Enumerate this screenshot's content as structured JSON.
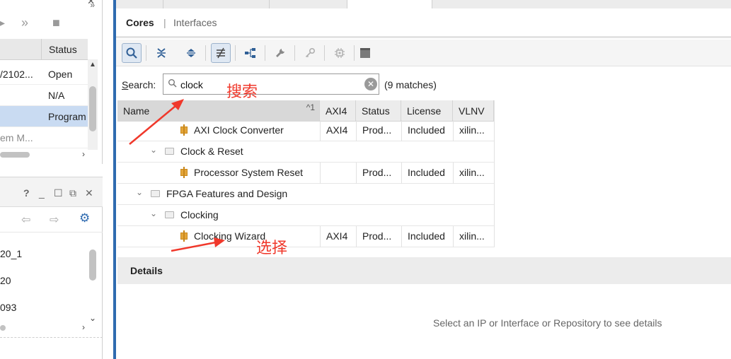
{
  "left_top_panel": {
    "columns": [
      "",
      "Status"
    ],
    "rows": [
      {
        "name": "/2102...",
        "status": "Open"
      },
      {
        "name": "",
        "status": "N/A"
      },
      {
        "name": "",
        "status": "Program"
      },
      {
        "name": "em M...",
        "status": ""
      }
    ]
  },
  "left_bottom_panel": {
    "controls": [
      "?",
      "_",
      "☐",
      "⧉",
      "✕"
    ],
    "items": [
      "20_1",
      "20",
      "093"
    ]
  },
  "view_tabs": {
    "cores": "Cores",
    "separator": "|",
    "interfaces": "Interfaces"
  },
  "search": {
    "label_prefix": "S",
    "label_rest": "earch:",
    "value": "clock",
    "match_text": "(9 matches)"
  },
  "grid": {
    "headers": {
      "name": "Name",
      "sort_indicator": "^1",
      "axi4": "AXI4",
      "status": "Status",
      "license": "License",
      "vlnv": "VLNV"
    },
    "rows": [
      {
        "type": "ip",
        "name": "AXI Clock Converter",
        "axi4": "AXI4",
        "status": "Prod...",
        "license": "Included",
        "vlnv": "xilin..."
      },
      {
        "type": "folder",
        "name": "Clock & Reset",
        "axi4": "",
        "status": "",
        "license": "",
        "vlnv": ""
      },
      {
        "type": "ip",
        "name": "Processor System Reset",
        "axi4": "",
        "status": "Prod...",
        "license": "Included",
        "vlnv": "xilin..."
      },
      {
        "type": "folder",
        "name": "FPGA Features and Design",
        "axi4": "",
        "status": "",
        "license": "",
        "vlnv": ""
      },
      {
        "type": "folder",
        "name": "Clocking",
        "axi4": "",
        "status": "",
        "license": "",
        "vlnv": ""
      },
      {
        "type": "ip",
        "name": "Clocking Wizard",
        "axi4": "AXI4",
        "status": "Prod...",
        "license": "Included",
        "vlnv": "xilin..."
      }
    ]
  },
  "details": {
    "title": "Details",
    "message": "Select an IP or Interface or Repository to see details"
  },
  "annotations": {
    "search_note": "搜索",
    "select_note": "选择",
    "color": "#f0382b"
  },
  "colors": {
    "selection": "#c9dbf2",
    "panel_border": "#2f6bb0"
  }
}
